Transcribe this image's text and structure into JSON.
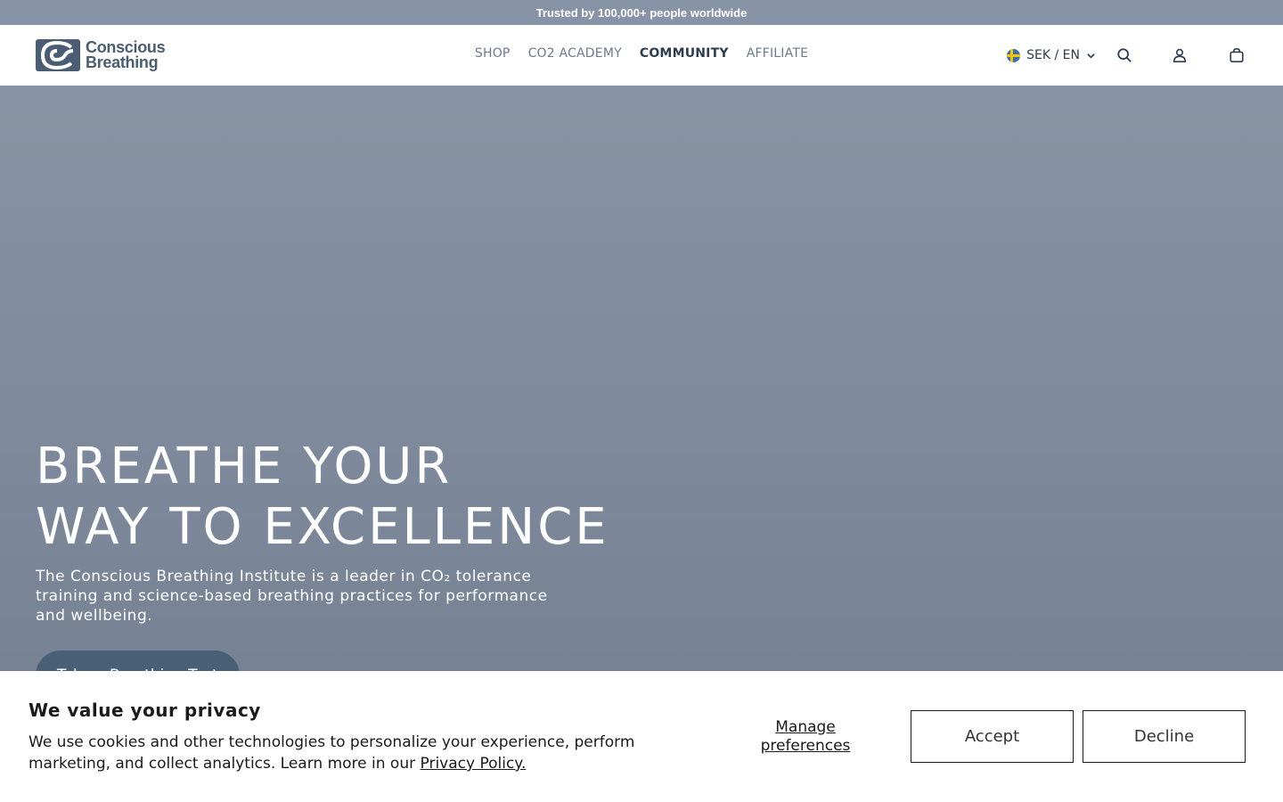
{
  "announcement": "Trusted by 100,000+ people worldwide",
  "brand": {
    "line1": "Conscious",
    "line2": "Breathing",
    "color": "#4a5d73"
  },
  "nav": [
    {
      "label": "SHOP"
    },
    {
      "label": "CO2 ACADEMY"
    },
    {
      "label": "COMMUNITY",
      "active": true
    },
    {
      "label": "AFFILIATE"
    }
  ],
  "header": {
    "locale": "SEK / EN",
    "icons": [
      "sweden-flag-icon",
      "chevron-down-icon",
      "search-icon",
      "account-icon",
      "cart-icon"
    ]
  },
  "hero": {
    "title_line1": "BREATHE YOUR",
    "title_line2": "WAY TO EXCELLENCE",
    "subtitle": "The Conscious Breathing Institute is a leader in CO₂ tolerance training and science-based breathing practices for performance and wellbeing.",
    "cta": "Take a Breathing Test"
  },
  "cookie": {
    "title": "We value your privacy",
    "body": "We use cookies and other technologies to personalize your experience, perform marketing, and collect analytics. Learn more in our ",
    "link": "Privacy Policy.",
    "manage": "Manage preferences",
    "accept": "Accept",
    "decline": "Decline"
  },
  "colors": {
    "announce_bg": "#8794a8",
    "hero_bg": "#7f8a9c",
    "cta_bg": "#4a6076"
  }
}
